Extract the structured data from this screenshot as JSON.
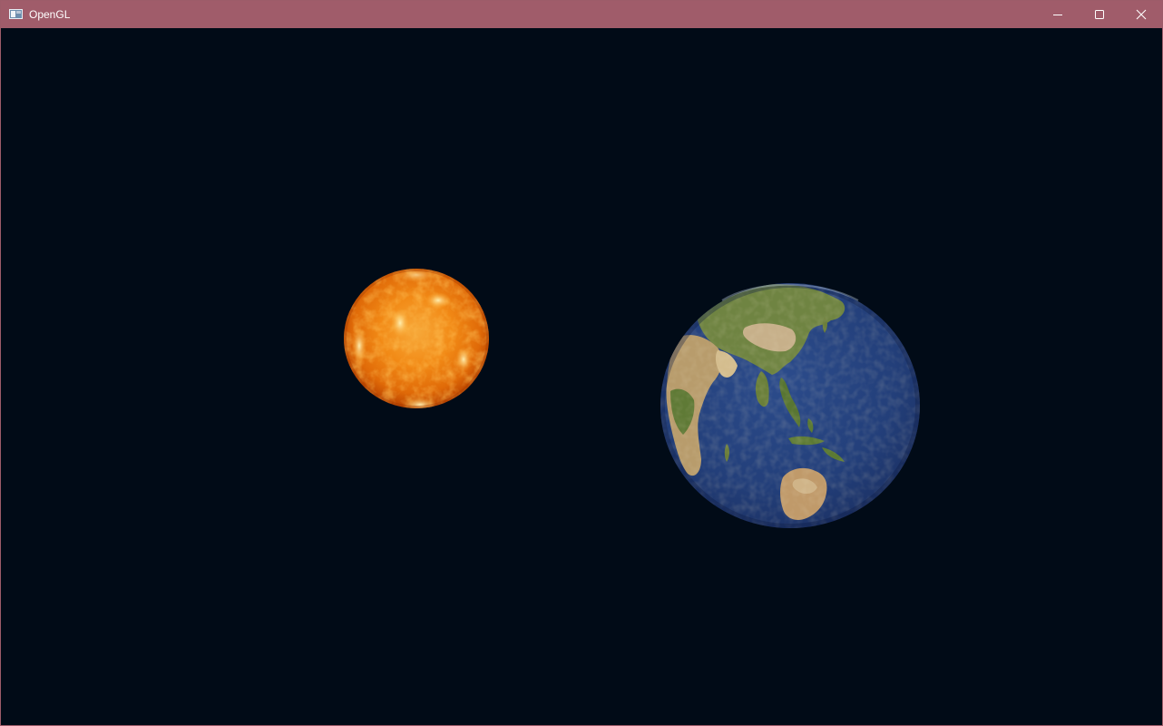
{
  "window": {
    "title": "OpenGL",
    "controls": {
      "minimize": "minimize",
      "maximize": "maximize",
      "close": "close"
    }
  },
  "scene": {
    "background_color": "#010b17",
    "objects": [
      "sun",
      "earth"
    ],
    "colors": {
      "sun_core": "#ffd37a",
      "sun_mid": "#f28a16",
      "sun_edge": "#c24a00",
      "earth_ocean": "#233f7a",
      "earth_land_green": "#5e7a3c",
      "earth_land_tan": "#c8aa7a"
    }
  }
}
